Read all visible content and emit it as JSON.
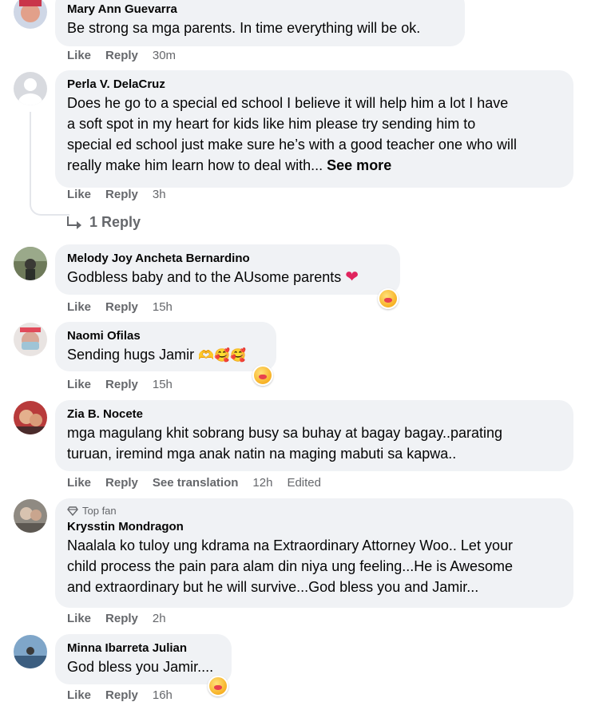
{
  "comments": [
    {
      "name": "Mary Ann Guevarra",
      "lines": [
        "Be strong sa mga parents. In time everything will be ok."
      ],
      "like": "Like",
      "reply": "Reply",
      "time": "30m"
    },
    {
      "name": "Perla V. DelaCruz",
      "lines": [
        "Does he go to a special ed school I believe it will help him a lot I have",
        "a soft spot in my heart for kids like him please try sending him to",
        "special ed school just make sure he’s with a good teacher one who will",
        "really make him learn how to deal with... "
      ],
      "see_more": "See more",
      "like": "Like",
      "reply": "Reply",
      "time": "3h",
      "replies_link": "1 Reply"
    },
    {
      "name": "Melody Joy Ancheta Bernardino",
      "text": "Godbless baby and to the AUsome parents",
      "like": "Like",
      "reply": "Reply",
      "time": "15h"
    },
    {
      "name": "Naomi Ofilas",
      "text": "Sending hugs Jamir",
      "like": "Like",
      "reply": "Reply",
      "time": "15h"
    },
    {
      "name": "Zia B. Nocete",
      "lines": [
        "mga magulang khit sobrang busy sa buhay at bagay bagay..parating",
        "turuan, iremind mga anak natin na maging mabuti sa kapwa.."
      ],
      "like": "Like",
      "reply": "Reply",
      "translate": "See translation",
      "time": "12h",
      "edited": "Edited"
    },
    {
      "badge": "Top fan",
      "name": "Krysstin Mondragon",
      "lines": [
        "Naalala ko tuloy ung kdrama na Extraordinary Attorney Woo.. Let your",
        "child process the pain para alam din niya ung feeling...He is Awesome",
        "and extraordinary but he will survive...God bless you and Jamir..."
      ],
      "like": "Like",
      "reply": "Reply",
      "time": "2h"
    },
    {
      "name": "Minna Ibarreta Julian",
      "text": "God bless you Jamir....",
      "like": "Like",
      "reply": "Reply",
      "time": "16h"
    }
  ],
  "colors": {
    "bubble": "#f0f2f5",
    "meta_text": "#65676b",
    "name_text": "#050505"
  },
  "icons": [
    "reply-arrow-icon",
    "diamond-icon",
    "care-reaction-icon",
    "heart-emoji-icon"
  ]
}
